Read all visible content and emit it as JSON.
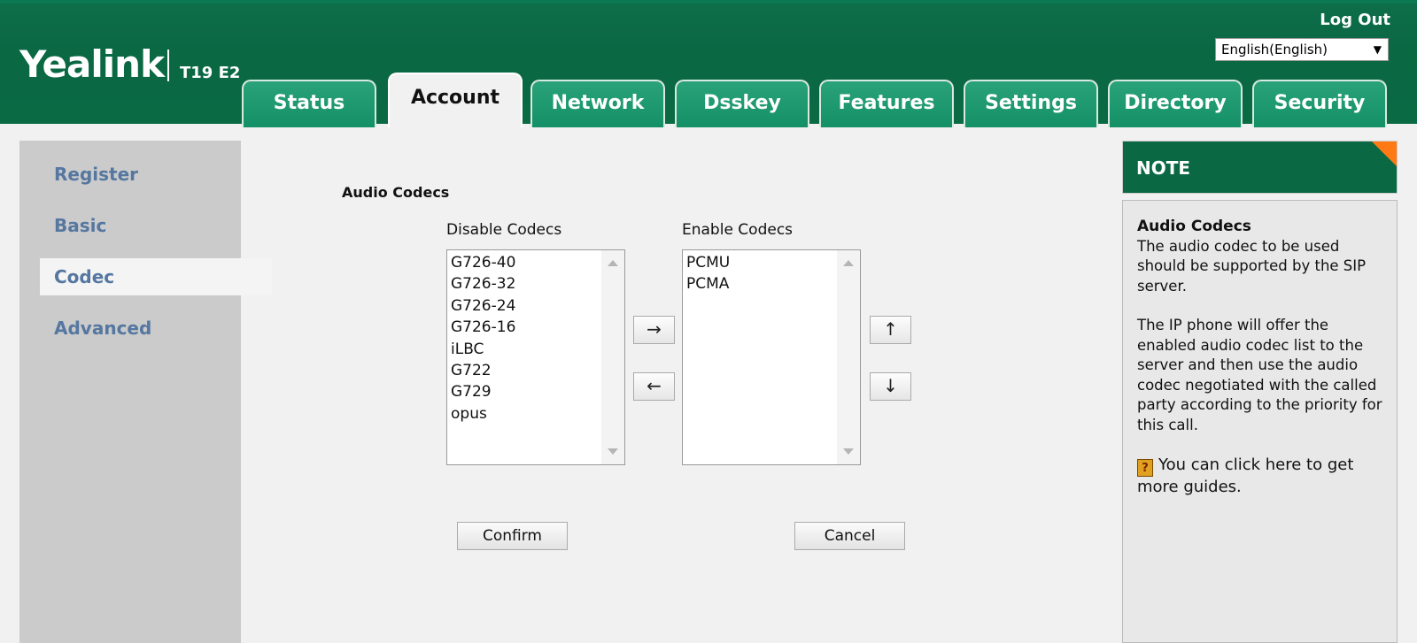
{
  "header": {
    "brand": "Yealink",
    "model": "T19 E2",
    "logout": "Log Out",
    "language": {
      "selected": "English(English)"
    },
    "tabs": [
      {
        "label": "Status"
      },
      {
        "label": "Account",
        "active": true
      },
      {
        "label": "Network"
      },
      {
        "label": "Dsskey"
      },
      {
        "label": "Features"
      },
      {
        "label": "Settings"
      },
      {
        "label": "Directory"
      },
      {
        "label": "Security"
      }
    ]
  },
  "sidebar": {
    "items": [
      {
        "label": "Register"
      },
      {
        "label": "Basic"
      },
      {
        "label": "Codec",
        "active": true
      },
      {
        "label": "Advanced"
      }
    ]
  },
  "main": {
    "section_title": "Audio Codecs",
    "disable_label": "Disable Codecs",
    "enable_label": "Enable Codecs",
    "disabled_codecs": [
      "G726-40",
      "G726-32",
      "G726-24",
      "G726-16",
      "iLBC",
      "G722",
      "G729",
      "opus"
    ],
    "enabled_codecs": [
      "PCMU",
      "PCMA"
    ],
    "move_right": "→",
    "move_left": "←",
    "move_up": "↑",
    "move_down": "↓",
    "confirm": "Confirm",
    "cancel": "Cancel"
  },
  "note": {
    "heading": "NOTE",
    "title": "Audio Codecs",
    "para1": "The audio codec to be used should be supported by the SIP server.",
    "para2": "The IP phone will offer the enabled audio codec list to the server and then use the audio codec negotiated with the called party according to the priority for this call.",
    "guide": "You can click here to get more guides."
  },
  "colors": {
    "header_green": "#0a6843",
    "tab_green": "#1a956b",
    "nav_text": "#5577a0",
    "accent_orange": "#ff7a14"
  }
}
